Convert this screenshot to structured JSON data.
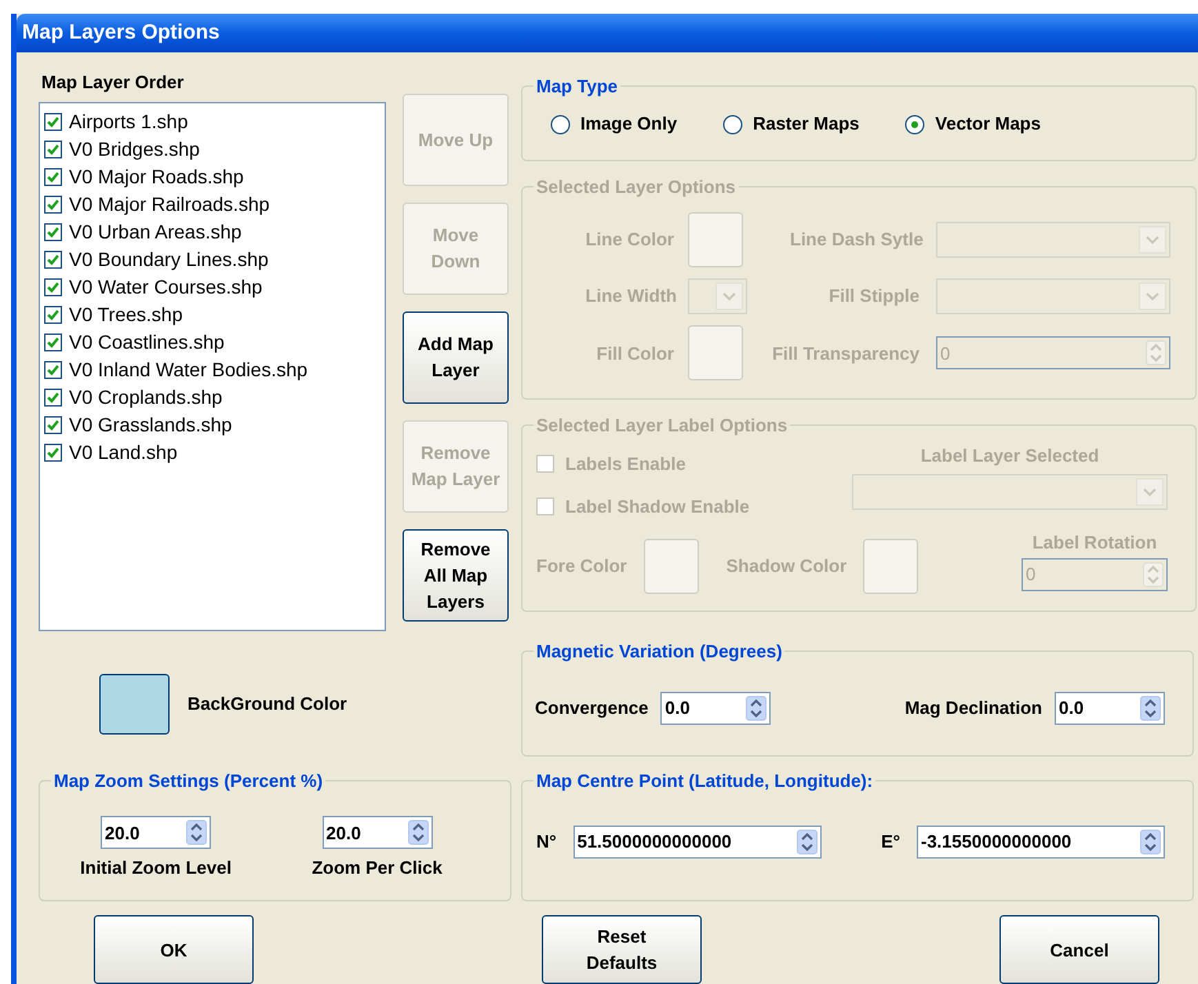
{
  "window": {
    "title": "Map Layers Options"
  },
  "layer_order": {
    "label": "Map Layer Order",
    "layers": [
      {
        "name": "Airports 1.shp",
        "checked": true
      },
      {
        "name": "V0 Bridges.shp",
        "checked": true
      },
      {
        "name": "V0 Major Roads.shp",
        "checked": true
      },
      {
        "name": "V0 Major Railroads.shp",
        "checked": true
      },
      {
        "name": "V0 Urban Areas.shp",
        "checked": true
      },
      {
        "name": "V0 Boundary Lines.shp",
        "checked": true
      },
      {
        "name": "V0 Water Courses.shp",
        "checked": true
      },
      {
        "name": "V0 Trees.shp",
        "checked": true
      },
      {
        "name": "V0 Coastlines.shp",
        "checked": true
      },
      {
        "name": "V0 Inland Water Bodies.shp",
        "checked": true
      },
      {
        "name": "V0 Croplands.shp",
        "checked": true
      },
      {
        "name": "V0 Grasslands.shp",
        "checked": true
      },
      {
        "name": "V0 Land.shp",
        "checked": true
      }
    ]
  },
  "layer_buttons": [
    {
      "label": "Move Up",
      "disabled": true
    },
    {
      "label": "Move Down",
      "disabled": true
    },
    {
      "label": "Add Map Layer",
      "disabled": false
    },
    {
      "label": "Remove Map Layer",
      "disabled": true
    },
    {
      "label": "Remove All Map Layers",
      "disabled": false
    }
  ],
  "background_color": {
    "label": "BackGround Color"
  },
  "map_type": {
    "legend": "Map Type",
    "options": [
      {
        "label": "Image Only",
        "selected": false
      },
      {
        "label": "Raster Maps",
        "selected": false
      },
      {
        "label": "Vector Maps",
        "selected": true
      }
    ]
  },
  "selected_layer_options": {
    "legend": "Selected Layer Options",
    "disabled": true,
    "line_color": "Line Color",
    "line_dash_style": "Line Dash Sytle",
    "line_width": "Line Width",
    "fill_stipple": "Fill Stipple",
    "fill_color": "Fill Color",
    "fill_transparency": {
      "label": "Fill Transparency",
      "value": "0"
    }
  },
  "label_options": {
    "legend": "Selected Layer Label Options",
    "disabled": true,
    "labels_enable": {
      "label": "Labels Enable",
      "checked": false
    },
    "label_shadow_enable": {
      "label": "Label Shadow Enable",
      "checked": false
    },
    "label_layer_selected": "Label Layer Selected",
    "fore_color": "Fore Color",
    "shadow_color": "Shadow Color",
    "label_rotation": {
      "label": "Label Rotation",
      "value": "0"
    }
  },
  "magnetic_variation": {
    "legend": "Magnetic Variation (Degrees)",
    "convergence": {
      "label": "Convergence",
      "value": "0.0"
    },
    "mag_declination": {
      "label": "Mag Declination",
      "value": "0.0"
    }
  },
  "zoom_settings": {
    "legend": "Map Zoom Settings (Percent %)",
    "initial": {
      "label": "Initial Zoom Level",
      "value": "20.0"
    },
    "per_click": {
      "label": "Zoom Per Click",
      "value": "20.0"
    }
  },
  "centre_point": {
    "legend": "Map Centre Point (Latitude, Longitude):",
    "latitude": {
      "label": "N°",
      "value": "51.5000000000000"
    },
    "longitude": {
      "label": "E°",
      "value": "-3.1550000000000"
    }
  },
  "footer_buttons": [
    "OK",
    "Reset Defaults",
    "Cancel"
  ]
}
